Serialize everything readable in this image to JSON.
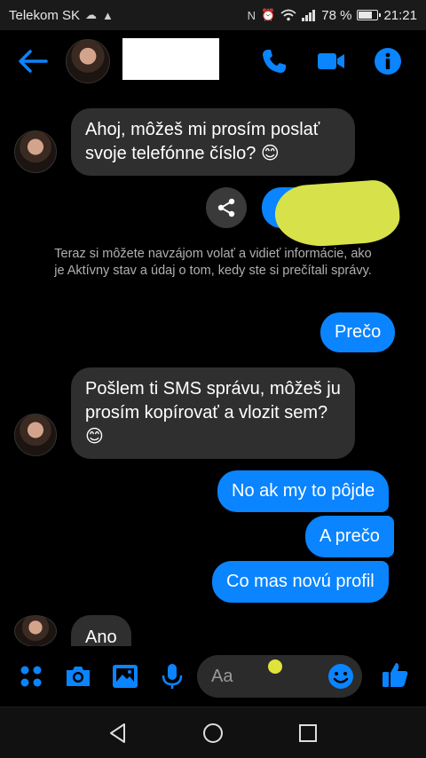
{
  "status_bar": {
    "carrier": "Telekom SK",
    "battery": "78 %",
    "battery_level": 0.78,
    "time": "21:21"
  },
  "header": {
    "contact_name": "",
    "icons": [
      "back-arrow-icon",
      "phone-icon",
      "video-camera-icon",
      "info-icon"
    ]
  },
  "messages": [
    {
      "side": "incoming",
      "text": "Ahoj, môžeš mi prosím poslať svoje telefónne číslo? 😊"
    },
    {
      "side": "outgoing",
      "type": "contact-card",
      "text": ""
    },
    {
      "side": "system",
      "text": "Teraz si môžete navzájom volať a vidieť informácie, ako je Aktívny stav a údaj o tom, kedy ste si prečítali správy."
    },
    {
      "side": "outgoing",
      "text": "Prečo"
    },
    {
      "side": "incoming",
      "text": "Pošlem ti SMS správu, môžeš ju prosím kopírovať a vlozit sem? 😊"
    },
    {
      "side": "outgoing",
      "text": "No ak my to pôjde"
    },
    {
      "side": "outgoing",
      "text": "A prečo"
    },
    {
      "side": "outgoing",
      "text": "Co mas novú profil"
    },
    {
      "side": "incoming",
      "text": "Ano"
    }
  ],
  "composer": {
    "placeholder": "Aa",
    "icons": [
      "apps-grid-icon",
      "camera-icon",
      "gallery-icon",
      "microphone-icon",
      "emoji-icon",
      "thumbs-up-icon"
    ]
  },
  "colors": {
    "accent": "#0a84ff",
    "incoming_bubble": "#2f2f2f",
    "background": "#000000"
  }
}
